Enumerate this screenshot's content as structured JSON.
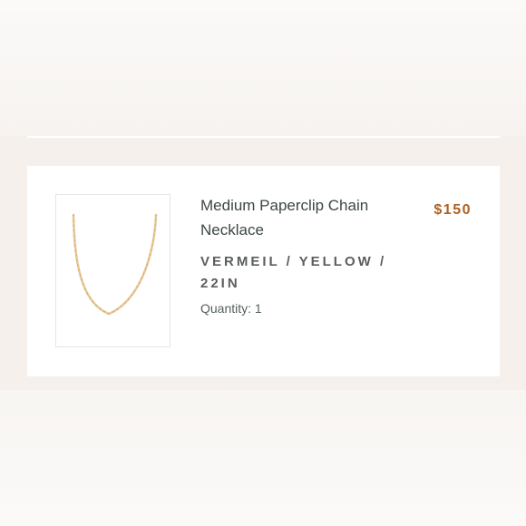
{
  "cart_item": {
    "product_name": "Medium Paperclip Chain Necklace",
    "price": "$150",
    "variant": "VERMEIL / YELLOW / 22IN",
    "quantity_text": "Quantity: 1",
    "image_icon": "necklace-chain-icon"
  },
  "colors": {
    "price": "#b0611f",
    "title": "#3c4842",
    "chain": "#d9b37a"
  }
}
